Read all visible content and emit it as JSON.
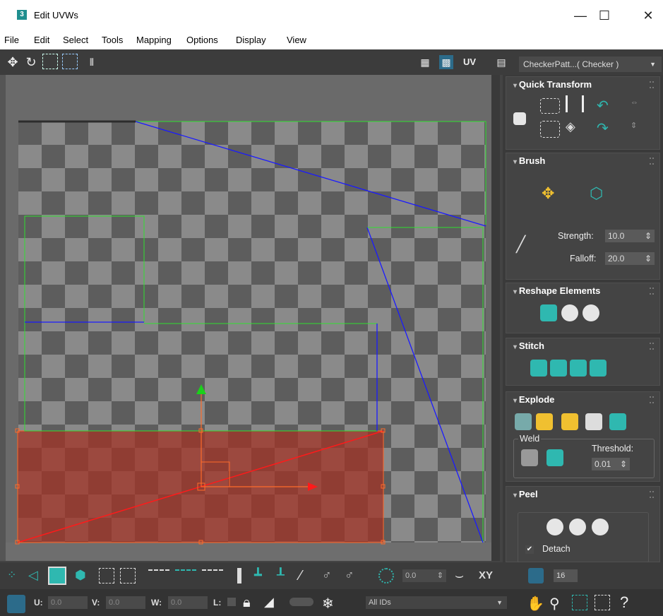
{
  "window": {
    "title": "Edit UVWs",
    "app_icon": "3",
    "minimize": "—",
    "maximize": "☐",
    "close": "✕"
  },
  "menu": [
    "File",
    "Edit",
    "Select",
    "Tools",
    "Mapping",
    "Options",
    "Display",
    "View"
  ],
  "toolbar": {
    "uv_label": "UV",
    "texture_dropdown": "CheckerPatt...( Checker )",
    "dropdown_arrow": "▼"
  },
  "panels": {
    "quick_transform": {
      "title": "Quick Transform"
    },
    "brush": {
      "title": "Brush",
      "strength_label": "Strength:",
      "strength_value": "10.0",
      "falloff_label": "Falloff:",
      "falloff_value": "20.0"
    },
    "reshape": {
      "title": "Reshape Elements"
    },
    "stitch": {
      "title": "Stitch"
    },
    "explode": {
      "title": "Explode",
      "weld_label": "Weld",
      "threshold_label": "Threshold:",
      "threshold_value": "0.01"
    },
    "peel": {
      "title": "Peel",
      "detach_label": "Detach",
      "detach_checked": true
    }
  },
  "bottom_bar": {
    "rotation_value": "0.0",
    "xy_label": "XY",
    "divisions_value": "16",
    "u_label": "U:",
    "u_value": "0.0",
    "v_label": "V:",
    "v_value": "0.0",
    "w_label": "W:",
    "w_value": "0.0",
    "l_label": "L:",
    "id_filter": "All IDs"
  },
  "colors": {
    "selection_fill": "#a43022",
    "gizmo_orange": "#ff6b2a",
    "gizmo_green": "#1ad11a",
    "edge_blue": "#1a1aff",
    "edge_green": "#30e030",
    "accent_teal": "#2fb8b0"
  }
}
